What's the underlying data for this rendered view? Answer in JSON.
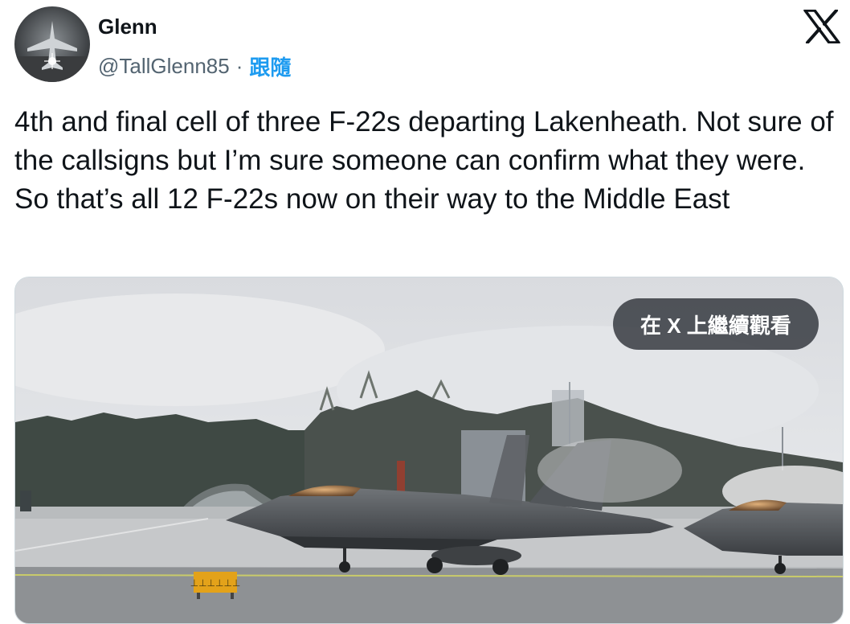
{
  "user": {
    "name": "Glenn",
    "handle": "@TallGlenn85",
    "separator": "·",
    "follow_label": "跟隨"
  },
  "brand": {
    "logo_icon": "x-logo-icon"
  },
  "tweet": {
    "text": "4th and final cell of three F-22s departing Lakenheath. Not sure of the callsigns but I’m sure someone can confirm what they were. So that’s all 12 F-22s now on their way to the Middle East"
  },
  "media": {
    "watch_on_x_label": "在 X 上繼續觀看",
    "sign_text": "⊥⊥⊥⊥⊥⊥"
  },
  "colors": {
    "text": "#0f1419",
    "secondary": "#536471",
    "accent": "#1d9bf0",
    "pill_bg": "#2b2f36"
  }
}
